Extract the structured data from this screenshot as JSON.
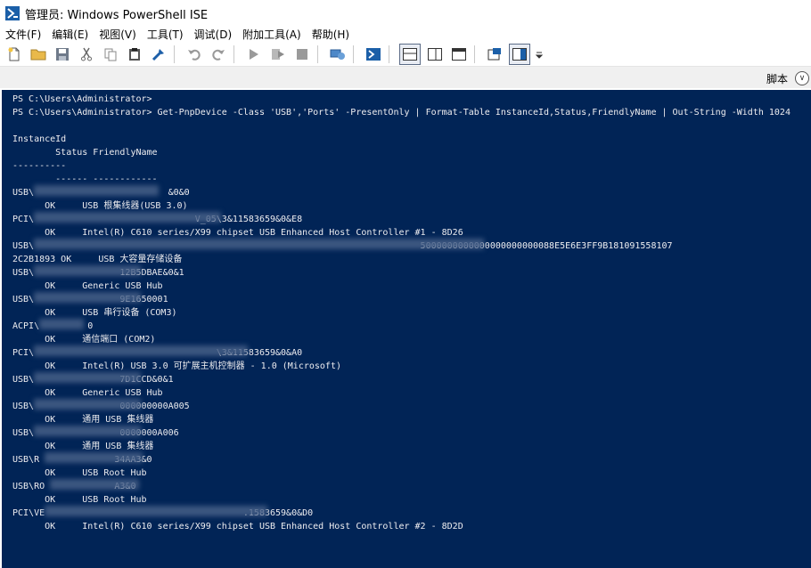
{
  "window": {
    "title": "管理员: Windows PowerShell ISE"
  },
  "menu": [
    "文件(F)",
    "编辑(E)",
    "视图(V)",
    "工具(T)",
    "调试(D)",
    "附加工具(A)",
    "帮助(H)"
  ],
  "toolbar_icons": [
    "new-file-icon",
    "open-file-icon",
    "save-icon",
    "cut-icon",
    "copy-icon",
    "paste-icon",
    "clear-icon",
    "undo-icon",
    "redo-icon",
    "run-script-icon",
    "run-selection-icon",
    "stop-icon",
    "remote-tab-icon",
    "powershell-console-icon",
    "layout-top-icon",
    "layout-right-icon",
    "layout-maximized-icon",
    "show-command-icon",
    "show-addon-icon",
    "more-icon"
  ],
  "scriptbar": {
    "label": "脚本"
  },
  "console": {
    "lines": [
      "PS C:\\Users\\Administrator>",
      "PS C:\\Users\\Administrator> Get-PnpDevice -Class 'USB','Ports' -PresentOnly | Format-Table InstanceId,Status,FriendlyName | Out-String -Width 1024",
      "",
      "InstanceId",
      "        Status FriendlyName",
      "----------",
      "        ------ ------------",
      "USB\\                         &0&0",
      "      OK     USB 根集线器(USB 3.0)",
      "PCI\\                              V_05\\3&11583659&0&E8",
      "      OK     Intel(R) C610 series/X99 chipset USB Enhanced Host Controller #1 - 8D26",
      "USB\\                                                                        5000000000000000000000088E5E6E3FF9B181091558107",
      "2C2B1893 OK     USB 大容量存储设备",
      "USB\\                12B5DBAE&0&1",
      "      OK     Generic USB Hub",
      "USB\\                9E1650001",
      "      OK     USB 串行设备 (COM3)",
      "ACPI\\         0",
      "      OK     通信端口 (COM2)",
      "PCI\\                                  \\3&11583659&0&A0",
      "      OK     Intel(R) USB 3.0 可扩展主机控制器 - 1.0 (Microsoft)",
      "USB\\                7D1CCD&0&1",
      "      OK     Generic USB Hub",
      "USB\\                000000000A005",
      "      OK     通用 USB 集线器",
      "USB\\                0000000A006",
      "      OK     通用 USB 集线器",
      "USB\\R              34AA3&0",
      "      OK     USB Root Hub",
      "USB\\RO             A3&0",
      "      OK     USB Root Hub",
      "PCI\\VE                                     .1583659&0&D0",
      "      OK     Intel(R) C610 series/X99 chipset USB Enhanced Host Controller #2 - 8D2D"
    ]
  },
  "colors": {
    "console_bg": "#012456",
    "console_fg": "#eeedf0"
  }
}
